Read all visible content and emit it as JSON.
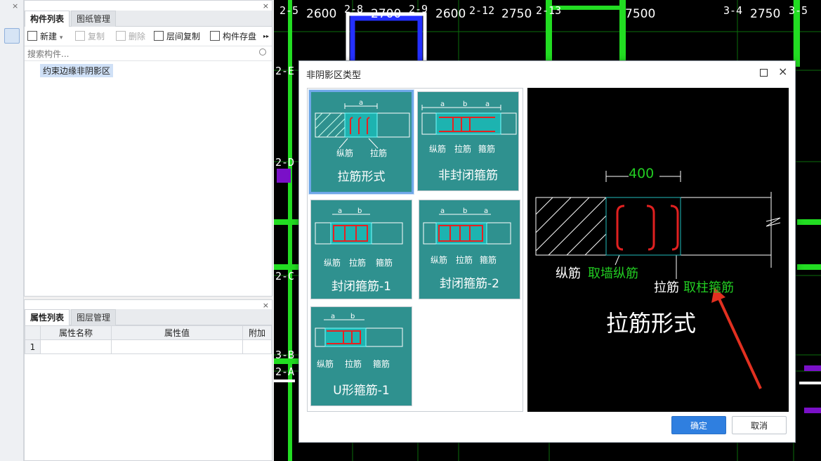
{
  "left_panel": {
    "close": "×",
    "tabs": [
      "构件列表",
      "图纸管理"
    ],
    "toolbar": {
      "new": "新建",
      "copy": "复制",
      "delete": "删除",
      "floor_copy": "层间复制",
      "save": "构件存盘",
      "more": "▸▸"
    },
    "search_placeholder": "搜索构件...",
    "tree_item": "约束边缘非阴影区"
  },
  "property_panel": {
    "close": "×",
    "tabs": [
      "属性列表",
      "图层管理"
    ],
    "columns": [
      "属性名称",
      "属性值",
      "附加"
    ],
    "rows": [
      "1"
    ]
  },
  "cad": {
    "grid_labels": [
      "2-5",
      "2-8",
      "2-9",
      "2-12",
      "2-13",
      "3-4",
      "3-5",
      "2-E",
      "2-D",
      "2-C",
      "3-B",
      "2-A"
    ],
    "dimensions": [
      "2600",
      "2700",
      "2600",
      "2750",
      "7500",
      "2750"
    ]
  },
  "dialog": {
    "title": "非阴影区类型",
    "maximize": "□",
    "close": "×",
    "options": [
      {
        "name": "拉筋形式",
        "labels": [
          "纵筋",
          "拉筋"
        ],
        "dims": [
          "a"
        ],
        "selected": true
      },
      {
        "name": "非封闭箍筋",
        "labels": [
          "纵筋",
          "拉筋",
          "箍筋"
        ],
        "dims": [
          "a",
          "b",
          "a"
        ],
        "selected": false
      },
      {
        "name": "封闭箍筋-1",
        "labels": [
          "纵筋",
          "拉筋",
          "箍筋"
        ],
        "dims": [
          "a",
          "b"
        ],
        "selected": false
      },
      {
        "name": "封闭箍筋-2",
        "labels": [
          "纵筋",
          "拉筋",
          "箍筋"
        ],
        "dims": [
          "a",
          "b",
          "a"
        ],
        "selected": false
      },
      {
        "name": "U形箍筋-1",
        "labels": [
          "纵筋",
          "拉筋",
          "箍筋"
        ],
        "dims": [
          "a",
          "b"
        ],
        "selected": false
      }
    ],
    "preview": {
      "dimension": "400",
      "label_long_prefix": "纵筋",
      "label_long_note": "取墙纵筋",
      "label_tie_prefix": "拉筋",
      "label_tie_note": "取柱箍筋",
      "title": "拉筋形式",
      "accent_color": "#22cc22",
      "rebar_color": "#e02020"
    },
    "ok_label": "确定",
    "cancel_label": "取消"
  }
}
